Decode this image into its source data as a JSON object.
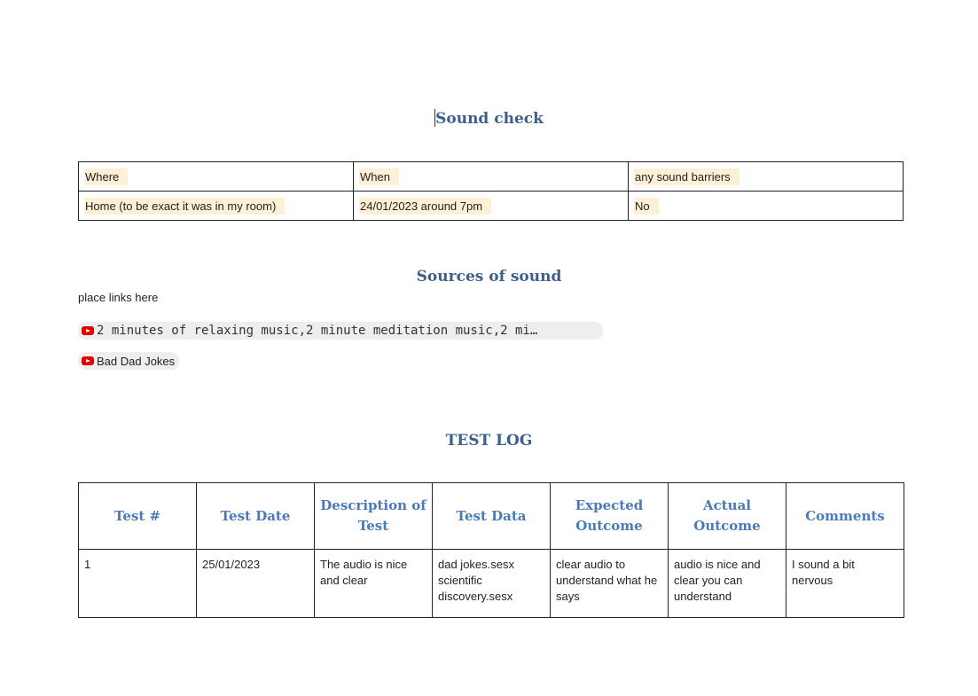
{
  "document": {
    "title": "Sound check",
    "info_table": {
      "headers": [
        "Where",
        "When",
        "any sound barriers"
      ],
      "row": [
        "Home (to be exact it was in my room)",
        "24/01/2023 around 7pm",
        "No"
      ]
    },
    "sources": {
      "heading": "Sources of sound",
      "note": "place links here",
      "links": [
        {
          "icon": "youtube-icon",
          "text": "2 minutes of relaxing music,2 minute meditation music,2 mi…"
        },
        {
          "icon": "youtube-icon",
          "text": "Bad Dad Jokes"
        }
      ]
    },
    "test_log": {
      "heading": "TEST LOG",
      "columns": [
        "Test #",
        "Test Date",
        "Description of Test",
        "Test Data",
        "Expected Outcome",
        "Actual Outcome",
        "Comments"
      ],
      "rows": [
        [
          "1",
          "25/01/2023",
          "The audio is nice and clear",
          "dad jokes.sesx scientific discovery.sesx",
          "clear audio to understand what he says",
          "audio is nice and clear you can understand",
          "I sound a bit nervous"
        ]
      ]
    }
  },
  "colors": {
    "heading": "#3d5f8c",
    "table_header": "#4a7ab8",
    "highlight": "#fdf0d5",
    "youtube": "#e00000"
  }
}
